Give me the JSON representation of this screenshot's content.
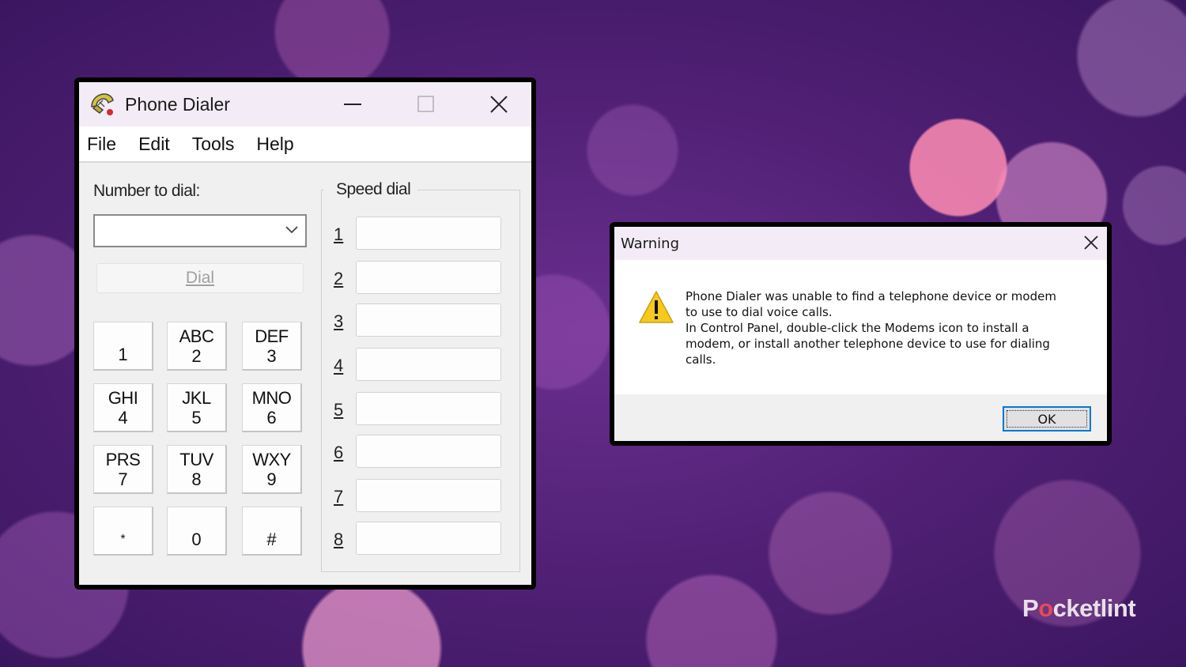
{
  "dialer": {
    "title": "Phone Dialer",
    "menu": [
      "File",
      "Edit",
      "Tools",
      "Help"
    ],
    "number_label": "Number to dial:",
    "number_value": "",
    "dial_label": "Dial",
    "keypad": [
      {
        "letters": "",
        "digit": "1"
      },
      {
        "letters": "ABC",
        "digit": "2"
      },
      {
        "letters": "DEF",
        "digit": "3"
      },
      {
        "letters": "GHI",
        "digit": "4"
      },
      {
        "letters": "JKL",
        "digit": "5"
      },
      {
        "letters": "MNO",
        "digit": "6"
      },
      {
        "letters": "PRS",
        "digit": "7"
      },
      {
        "letters": "TUV",
        "digit": "8"
      },
      {
        "letters": "WXY",
        "digit": "9"
      },
      {
        "letters": "",
        "digit": "*"
      },
      {
        "letters": "",
        "digit": "0"
      },
      {
        "letters": "",
        "digit": "#"
      }
    ],
    "speed_dial_label": "Speed dial",
    "speed_dial": [
      "1",
      "2",
      "3",
      "4",
      "5",
      "6",
      "7",
      "8"
    ]
  },
  "warning": {
    "title": "Warning",
    "message_lines": [
      "Phone Dialer was unable to find a telephone device or modem",
      "to use to dial voice calls.",
      "In Control Panel, double-click the Modems icon to install a",
      "modem, or install another telephone device to use for dialing",
      "calls."
    ],
    "ok_label": "OK"
  },
  "watermark": {
    "prefix": "P",
    "accent": "o",
    "suffix": "cketlint"
  },
  "colors": {
    "accent_blue": "#0078d7",
    "warning_yellow": "#f7c81e",
    "brand_red": "#e8495a"
  }
}
